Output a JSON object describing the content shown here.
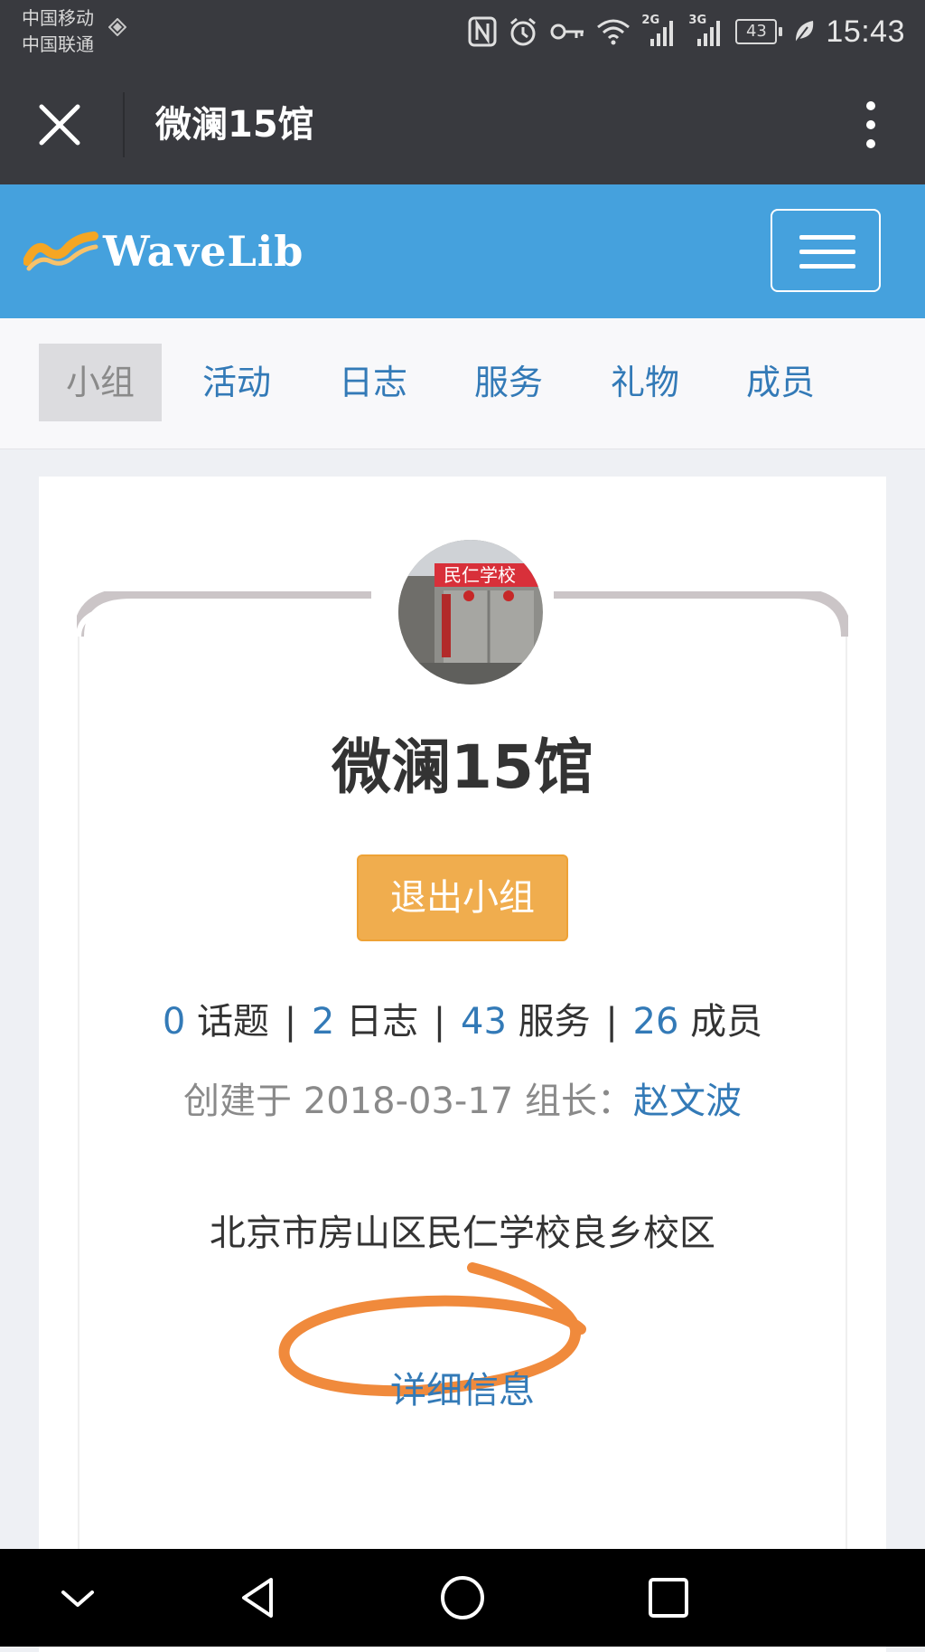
{
  "status_bar": {
    "carrier_1": "中国移动",
    "carrier_2": "中国联通",
    "battery": "43",
    "time": "15:43",
    "net_1": "2G",
    "net_2": "3G",
    "icons": [
      "nfc-icon",
      "alarm-icon",
      "key-icon",
      "wifi-icon",
      "signal-icon",
      "battery-icon",
      "leaf-icon"
    ]
  },
  "titlebar": {
    "title": "微澜15馆",
    "close_icon": "close-icon",
    "more_icon": "more-vertical-icon"
  },
  "header": {
    "logo_text": "WaveLib",
    "menu_icon": "hamburger-icon",
    "colors": {
      "background": "#45a1dd",
      "logo_wave": "#f5a623"
    }
  },
  "tabs": [
    {
      "label": "小组",
      "active": true
    },
    {
      "label": "活动",
      "active": false
    },
    {
      "label": "日志",
      "active": false
    },
    {
      "label": "服务",
      "active": false
    },
    {
      "label": "礼物",
      "active": false
    },
    {
      "label": "成员",
      "active": false
    }
  ],
  "group": {
    "name": "微澜15馆",
    "avatar_sign_text": "民仁学校",
    "leave_button": "退出小组",
    "stats": {
      "topics_count": "0",
      "topics_label": "话题",
      "logs_count": "2",
      "logs_label": "日志",
      "services_count": "43",
      "services_label": "服务",
      "members_count": "26",
      "members_label": "成员",
      "separator": "|"
    },
    "created_prefix": "创建于",
    "created_date": "2018-03-17",
    "owner_label": "组长：",
    "owner_name": "赵文波",
    "address": "北京市房山区民仁学校良乡校区",
    "detail_link": "详细信息"
  },
  "colors": {
    "link": "#337ab7",
    "warning_button": "#f0ad4e",
    "annotation_stroke": "#f08a3c",
    "system_bar": "#393a3f"
  },
  "navbar": {
    "buttons": [
      "collapse-icon",
      "back-icon",
      "home-icon",
      "recents-icon"
    ]
  }
}
